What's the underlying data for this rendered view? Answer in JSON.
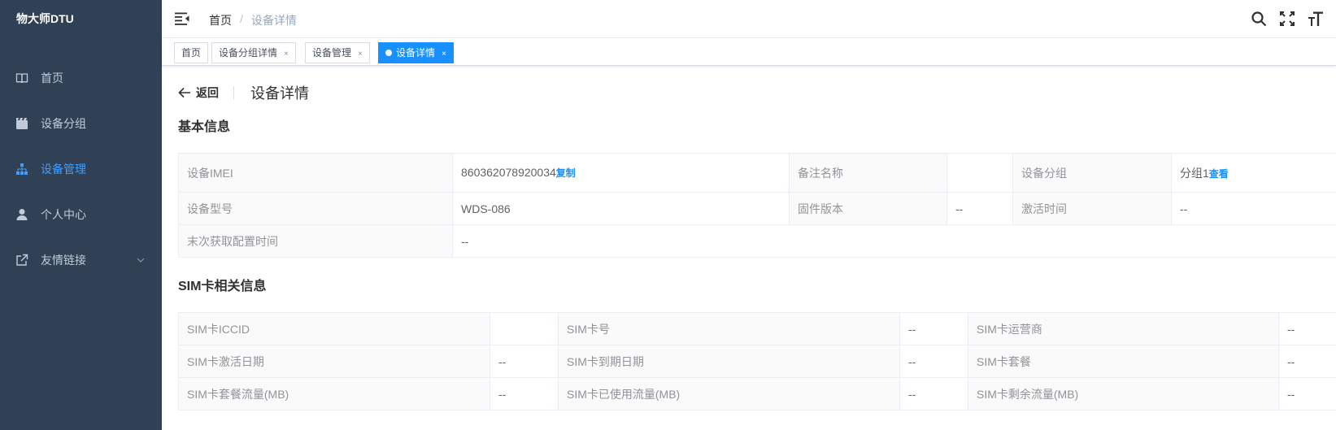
{
  "app": {
    "logo": "物大师DTU"
  },
  "sidebar": {
    "items": [
      {
        "label": "首页",
        "icon": "book-icon",
        "active": false
      },
      {
        "label": "设备分组",
        "icon": "clapperboard-icon",
        "active": false
      },
      {
        "label": "设备管理",
        "icon": "org-tree-icon",
        "active": true
      },
      {
        "label": "个人中心",
        "icon": "user-icon",
        "active": false
      },
      {
        "label": "友情链接",
        "icon": "external-link-icon",
        "active": false,
        "expandable": true
      }
    ]
  },
  "navbar": {
    "breadcrumb": [
      "首页",
      "设备详情"
    ],
    "separator": "/",
    "tools": [
      "search-icon",
      "fullscreen-icon",
      "font-size-icon"
    ]
  },
  "tags": [
    {
      "label": "首页",
      "closable": false,
      "active": false
    },
    {
      "label": "设备分组详情",
      "closable": true,
      "active": false
    },
    {
      "label": "设备管理",
      "closable": true,
      "active": false
    },
    {
      "label": "设备详情",
      "closable": true,
      "active": true
    }
  ],
  "tag_close": "×",
  "page_header": {
    "back": "返回",
    "title": "设备详情"
  },
  "basic": {
    "title": "基本信息",
    "imei_label": "设备IMEI",
    "imei_value": "860362078920034",
    "copy": "复制",
    "remark_label": "备注名称",
    "remark_value": "",
    "group_label": "设备分组",
    "group_value": "分组1",
    "view": "查看",
    "model_label": "设备型号",
    "model_value": "WDS-086",
    "firmware_label": "固件版本",
    "firmware_value": "--",
    "activate_label": "激活时间",
    "activate_value": "--",
    "lastcfg_label": "末次获取配置时间",
    "lastcfg_value": "--"
  },
  "sim": {
    "title": "SIM卡相关信息",
    "rows": [
      [
        {
          "label": "SIM卡ICCID",
          "value": ""
        },
        {
          "label": "SIM卡号",
          "value": "--"
        },
        {
          "label": "SIM卡运营商",
          "value": "--"
        }
      ],
      [
        {
          "label": "SIM卡激活日期",
          "value": "--"
        },
        {
          "label": "SIM卡到期日期",
          "value": "--"
        },
        {
          "label": "SIM卡套餐",
          "value": "--"
        }
      ],
      [
        {
          "label": "SIM卡套餐流量(MB)",
          "value": "--"
        },
        {
          "label": "SIM卡已使用流量(MB)",
          "value": "--"
        },
        {
          "label": "SIM卡剩余流量(MB)",
          "value": "--"
        }
      ]
    ]
  },
  "colors": {
    "sidebar_bg": "#304156",
    "accent": "#1890ff",
    "menu_text": "#bfcbd9",
    "active_menu": "#409eff"
  }
}
